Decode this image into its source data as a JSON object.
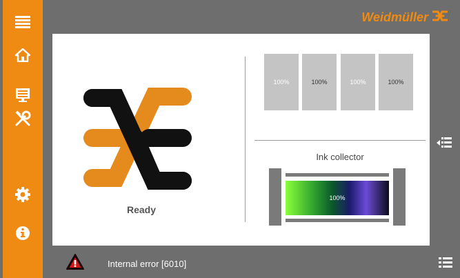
{
  "brand": {
    "name": "Weidmüller",
    "color": "#ef8a12"
  },
  "sidebar": {
    "items": [
      {
        "id": "menu",
        "icon": "hamburger-menu-icon"
      },
      {
        "id": "home",
        "icon": "home-icon"
      },
      {
        "id": "display",
        "icon": "monitor-icon"
      },
      {
        "id": "tools",
        "icon": "tools-icon"
      },
      {
        "id": "settings",
        "icon": "gear-icon"
      },
      {
        "id": "info",
        "icon": "info-icon"
      }
    ]
  },
  "status": {
    "label": "Ready"
  },
  "ink_levels": [
    {
      "label": "100%",
      "value": 100
    },
    {
      "label": "100%",
      "value": 100
    },
    {
      "label": "100%",
      "value": 100
    },
    {
      "label": "100%",
      "value": 100
    }
  ],
  "ink_collector": {
    "title": "Ink collector",
    "label": "100%",
    "value": 100
  },
  "error": {
    "message": "Internal error [6010]",
    "icon": "warning-icon"
  },
  "right_icons": {
    "upper": "collapse-list-icon",
    "lower": "list-icon"
  },
  "colors": {
    "accent": "#ef8a12",
    "frame": "#6e6e6e",
    "ink_slot": "#c4c4c4"
  }
}
